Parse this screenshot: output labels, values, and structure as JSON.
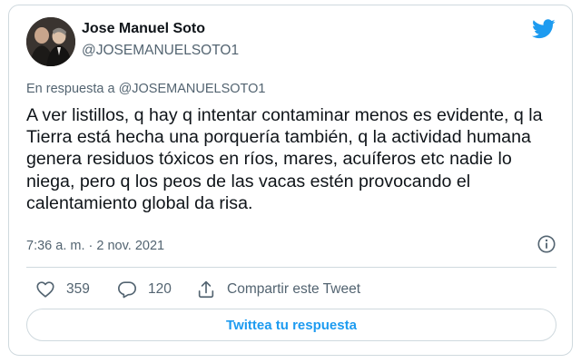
{
  "author": {
    "name": "Jose Manuel Soto",
    "handle": "@JOSEMANUELSOTO1",
    "avatar_icon": "avatar-photo"
  },
  "platform_icon": "twitter-bird-icon",
  "tweet": {
    "reply_to": "En respuesta a @JOSEMANUELSOTO1",
    "text": "A ver listillos, q hay q intentar contaminar menos es evidente, q la Tierra está hecha una porquería también, q la actividad humana genera residuos tóxicos en ríos, mares, acuíferos etc nadie lo niega, pero q los peos de las vacas estén provocando el calentamiento global da risa.",
    "timestamp": "7:36 a. m. · 2 nov. 2021"
  },
  "actions": {
    "likes": "359",
    "replies": "120",
    "share_label": "Compartir este Tweet"
  },
  "reply_button_label": "Twittea tu respuesta",
  "colors": {
    "accent": "#1d9bf0",
    "text": "#0f1419",
    "secondary": "#536471",
    "border": "#cfd9de"
  }
}
